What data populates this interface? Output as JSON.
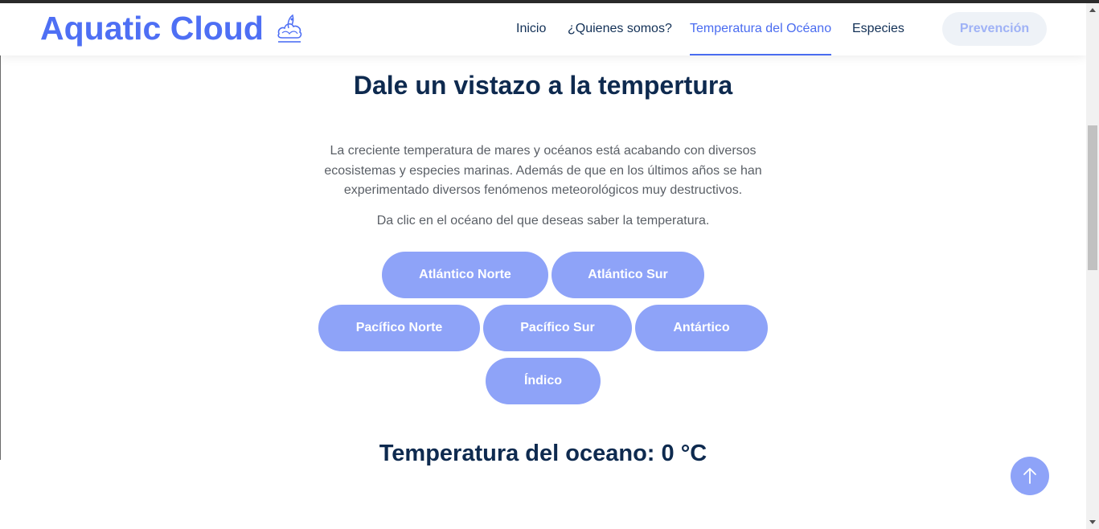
{
  "header": {
    "brand": "Aquatic Cloud",
    "logo_icon": "aquatic-cloud-logo-icon",
    "nav": [
      {
        "label": "Inicio",
        "active": false
      },
      {
        "label": "¿Quienes somos?",
        "active": false
      },
      {
        "label": "Temperatura del Océano",
        "active": true
      },
      {
        "label": "Especies",
        "active": false
      }
    ],
    "cta": "Prevención"
  },
  "main": {
    "title": "Dale un vistazo a la tempertura",
    "description": "La creciente temperatura de mares y océanos está acabando con diversos ecosistemas y especies marinas. Además de que en los últimos años se han experimentado diversos fenómenos meteorológicos muy destructivos.",
    "hint": "Da clic en el océano del que deseas saber la temperatura.",
    "oceans": [
      "Atlántico Norte",
      "Atlántico Sur",
      "Pacífico Norte",
      "Pacífico Sur",
      "Antártico",
      "Índico"
    ],
    "temperature_label": "Temperatura del oceano: 0 °C"
  },
  "scroll_top_icon": "arrow-up-icon",
  "colors": {
    "brand": "#4e6ff4",
    "heading": "#0e2a4f",
    "button": "#8ea3f8",
    "cta_bg": "#eef2f7",
    "cta_text": "#9fb2f6"
  }
}
